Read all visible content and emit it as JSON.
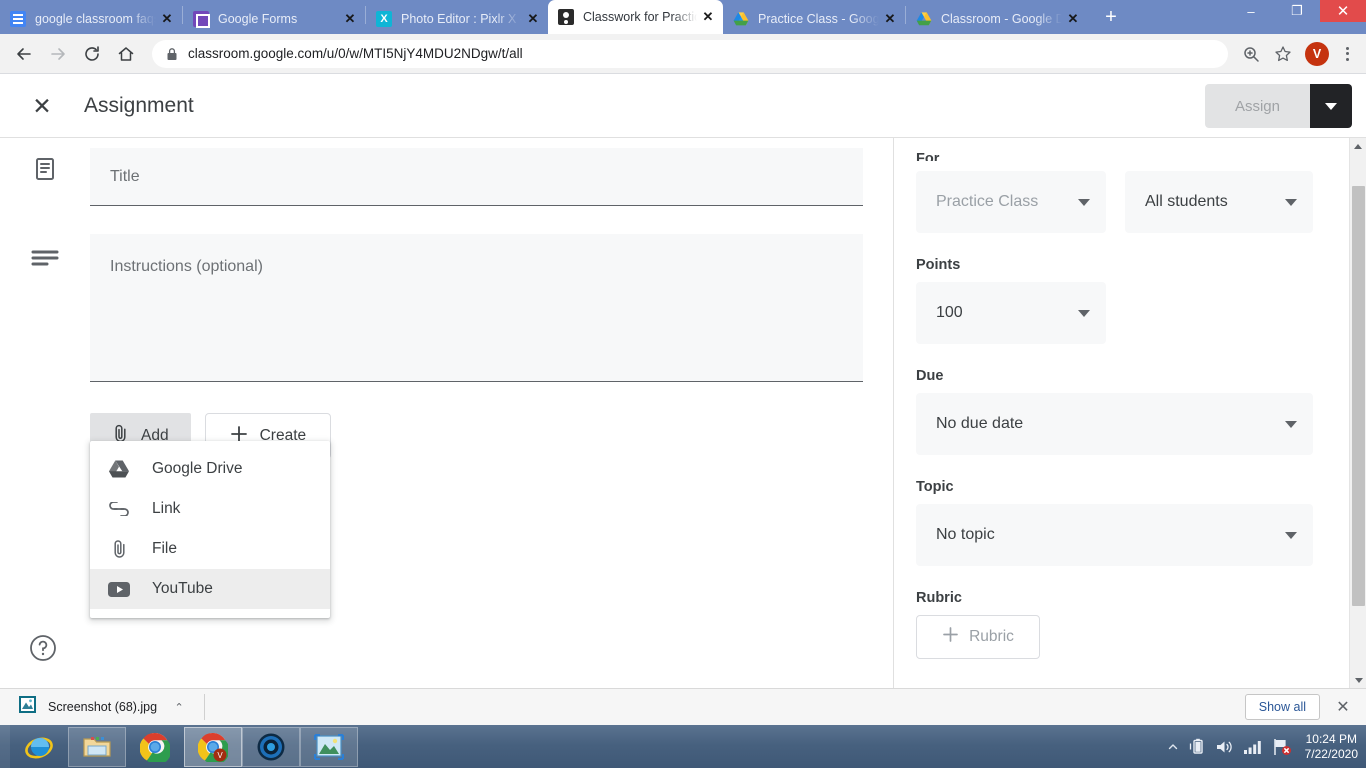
{
  "browser": {
    "tabs": [
      {
        "title": "google classroom faqs a",
        "favicon": "google-docs-icon",
        "active": false
      },
      {
        "title": "Google Forms",
        "favicon": "google-forms-icon",
        "active": false
      },
      {
        "title": "Photo Editor : Pixlr X - fre",
        "favicon": "pixlr-icon",
        "active": false
      },
      {
        "title": "Classwork for Practice Cl",
        "favicon": "google-classroom-icon",
        "active": true
      },
      {
        "title": "Practice Class - Google D",
        "favicon": "google-drive-icon",
        "active": false
      },
      {
        "title": "Classroom - Google Driv",
        "favicon": "google-drive-icon",
        "active": false
      }
    ],
    "new_tab_label": "+",
    "window_controls": {
      "minimize": "–",
      "maximize": "❐",
      "close": "✕"
    },
    "url": "classroom.google.com/u/0/w/MTI5NjY4MDU2NDgw/t/all",
    "profile_initial": "V"
  },
  "appbar": {
    "title": "Assignment",
    "assign_label": "Assign"
  },
  "form": {
    "title_placeholder": "Title",
    "instructions_placeholder": "Instructions (optional)",
    "add_label": "Add",
    "create_label": "Create",
    "menu": [
      {
        "label": "Google Drive",
        "icon": "google-drive-icon",
        "hover": false
      },
      {
        "label": "Link",
        "icon": "link-icon",
        "hover": false
      },
      {
        "label": "File",
        "icon": "paperclip-icon",
        "hover": false
      },
      {
        "label": "YouTube",
        "icon": "youtube-icon",
        "hover": true
      }
    ]
  },
  "sidebar": {
    "for_label": "For",
    "class_value": "Practice Class",
    "students_value": "All students",
    "points_label": "Points",
    "points_value": "100",
    "due_label": "Due",
    "due_value": "No due date",
    "topic_label": "Topic",
    "topic_value": "No topic",
    "rubric_label": "Rubric",
    "rubric_button": "Rubric"
  },
  "download_shelf": {
    "file_name": "Screenshot (68).jpg",
    "show_all_label": "Show all"
  },
  "taskbar": {
    "apps": [
      {
        "name": "internet-explorer-icon"
      },
      {
        "name": "file-explorer-icon"
      },
      {
        "name": "google-chrome-icon"
      },
      {
        "name": "google-chrome-active-icon"
      },
      {
        "name": "media-player-icon"
      },
      {
        "name": "photos-icon"
      }
    ],
    "time": "10:24 PM",
    "date": "7/22/2020"
  },
  "colors": {
    "tabstrip": "#6e8ac4",
    "assign_dark": "#222326",
    "avatar": "#c5330f",
    "field_bg": "#f7f8f9"
  }
}
